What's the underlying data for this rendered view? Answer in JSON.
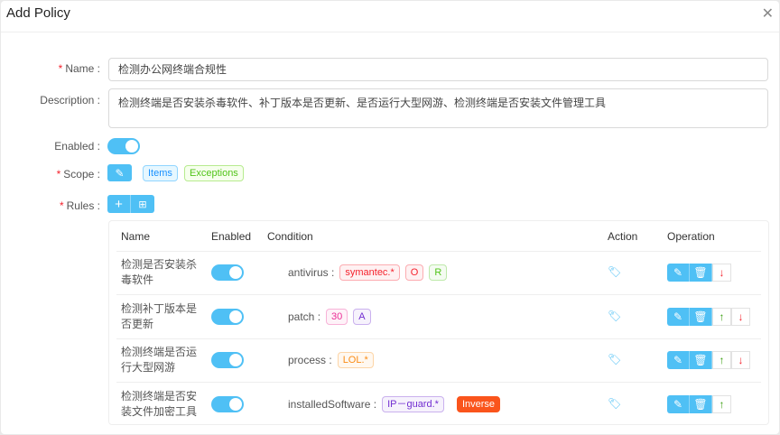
{
  "title": "Add Policy",
  "form": {
    "name_label": "Name :",
    "name_value": "检测办公网终端合规性",
    "description_label": "Description :",
    "description_value": "检测终端是否安装杀毒软件、补丁版本是否更新、是否运行大型网游、检测终端是否安装文件管理工具",
    "enabled_label": "Enabled :",
    "enabled": true,
    "scope_label": "Scope :",
    "scope_items": "Items",
    "scope_exceptions": "Exceptions",
    "rules_label": "Rules :"
  },
  "table": {
    "headers": [
      "Name",
      "Enabled",
      "Condition",
      "Action",
      "Operation"
    ],
    "rows": [
      {
        "name": "检测是否安装杀毒软件",
        "enabled": true,
        "key": "antivirus :",
        "tags": [
          {
            "text": "symantec.*",
            "color": "#f5222d"
          },
          {
            "text": "O",
            "color": "#f5222d"
          },
          {
            "text": "R",
            "color": "#52c41a"
          }
        ],
        "up": false,
        "down": true
      },
      {
        "name": "检测补丁版本是否更新",
        "enabled": true,
        "key": "patch :",
        "tags": [
          {
            "text": "30",
            "color": "#eb2f96"
          },
          {
            "text": "A",
            "color": "#722ed1"
          }
        ],
        "up": true,
        "down": true
      },
      {
        "name": "检测终端是否运行大型网游",
        "enabled": true,
        "key": "process :",
        "tags": [
          {
            "text": "LOL.*",
            "color": "#fa8c16"
          }
        ],
        "up": true,
        "down": true
      },
      {
        "name": "检测终端是否安装文件加密工具",
        "enabled": true,
        "key": "installedSoftware :",
        "tags": [
          {
            "text": "IP－guard.*",
            "color": "#722ed1"
          }
        ],
        "badge": "Inverse",
        "up": true,
        "down": false
      }
    ]
  },
  "colors": {
    "primary": "#4fc0f5",
    "inverse": "#fa541c"
  }
}
